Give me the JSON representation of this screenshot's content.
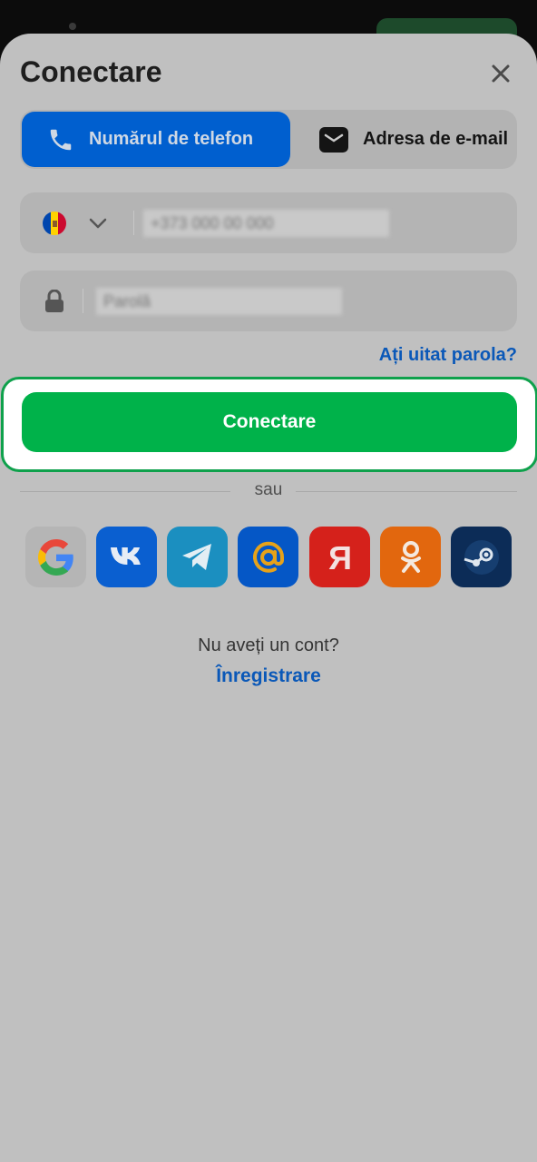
{
  "colors": {
    "sheet_bg": "#c0c0c0",
    "accent_blue": "#005fcf",
    "accent_green": "#00b24a",
    "link_blue": "#0a58b8"
  },
  "sheet": {
    "title": "Conectare",
    "close_icon": "close-icon"
  },
  "tabs": [
    {
      "label": "Numărul de telefon",
      "icon": "phone-icon",
      "active": true
    },
    {
      "label": "Adresa de e-mail",
      "icon": "mail-icon",
      "active": false
    }
  ],
  "phone_field": {
    "country": "Moldova",
    "placeholder": "+373 000 00 000"
  },
  "password_field": {
    "placeholder": "Parolă"
  },
  "forgot_password": "Ați uitat parola?",
  "submit_button": "Conectare",
  "divider_text": "sau",
  "social_providers": [
    {
      "name": "Google",
      "icon": "google-icon",
      "color": "#b5b5b5"
    },
    {
      "name": "VK",
      "icon": "vk-icon",
      "color": "#0a5fd0"
    },
    {
      "name": "Telegram",
      "icon": "telegram-icon",
      "color": "#1b8fc0"
    },
    {
      "name": "Mail.ru",
      "icon": "mailru-at-icon",
      "color": "#0557c6"
    },
    {
      "name": "Yandex",
      "icon": "yandex-icon",
      "color": "#d5211b"
    },
    {
      "name": "Odnoklassniki",
      "icon": "odnoklassniki-icon",
      "color": "#e2670e"
    },
    {
      "name": "Steam",
      "icon": "steam-icon",
      "color": "#0c2c57"
    }
  ],
  "signup_prompt": "Nu aveți un cont?",
  "signup_link": "Înregistrare"
}
